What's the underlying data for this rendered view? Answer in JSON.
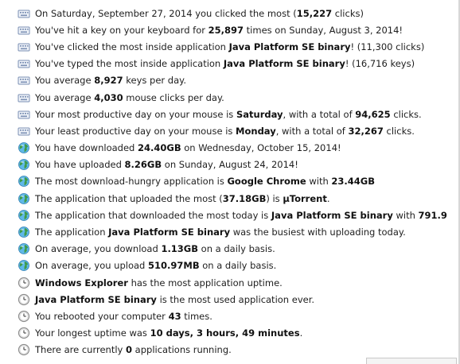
{
  "colors": {
    "keyboard_icon": "#7a8fb3",
    "globe_icon": "#3f9b48",
    "clock_icon": "#8c8c8c"
  },
  "rows": [
    {
      "icon": "keyboard-icon",
      "parts": [
        {
          "t": "On Saturday, September 27, 2014 you clicked the most ("
        },
        {
          "t": "15,227",
          "b": true
        },
        {
          "t": " clicks)"
        }
      ]
    },
    {
      "icon": "keyboard-icon",
      "parts": [
        {
          "t": "You've hit a key on your keyboard for "
        },
        {
          "t": "25,897",
          "b": true
        },
        {
          "t": " times on Sunday, August 3, 2014!"
        }
      ]
    },
    {
      "icon": "keyboard-icon",
      "parts": [
        {
          "t": "You've clicked the most inside application "
        },
        {
          "t": "Java Platform SE binary",
          "b": true
        },
        {
          "t": "! (11,300 clicks)"
        }
      ]
    },
    {
      "icon": "keyboard-icon",
      "parts": [
        {
          "t": "You've typed the most inside application "
        },
        {
          "t": "Java Platform SE binary",
          "b": true
        },
        {
          "t": "! (16,716 keys)"
        }
      ]
    },
    {
      "icon": "keyboard-icon",
      "parts": [
        {
          "t": "You average "
        },
        {
          "t": "8,927",
          "b": true
        },
        {
          "t": " keys per day."
        }
      ]
    },
    {
      "icon": "keyboard-icon",
      "parts": [
        {
          "t": "You average "
        },
        {
          "t": "4,030",
          "b": true
        },
        {
          "t": " mouse clicks per day."
        }
      ]
    },
    {
      "icon": "keyboard-icon",
      "parts": [
        {
          "t": "Your most productive day on your mouse is "
        },
        {
          "t": "Saturday",
          "b": true
        },
        {
          "t": ", with a total of "
        },
        {
          "t": "94,625",
          "b": true
        },
        {
          "t": " clicks."
        }
      ]
    },
    {
      "icon": "keyboard-icon",
      "parts": [
        {
          "t": "Your least productive day on your mouse is "
        },
        {
          "t": "Monday",
          "b": true
        },
        {
          "t": ", with a total of "
        },
        {
          "t": "32,267",
          "b": true
        },
        {
          "t": " clicks."
        }
      ]
    },
    {
      "icon": "globe-icon",
      "parts": [
        {
          "t": "You have downloaded "
        },
        {
          "t": "24.40GB",
          "b": true
        },
        {
          "t": " on Wednesday, October 15, 2014!"
        }
      ]
    },
    {
      "icon": "globe-icon",
      "parts": [
        {
          "t": "You have uploaded "
        },
        {
          "t": "8.26GB",
          "b": true
        },
        {
          "t": " on Sunday, August 24, 2014!"
        }
      ]
    },
    {
      "icon": "globe-icon",
      "parts": [
        {
          "t": "The most download-hungry application is "
        },
        {
          "t": "Google Chrome",
          "b": true
        },
        {
          "t": " with "
        },
        {
          "t": "23.44GB",
          "b": true
        }
      ]
    },
    {
      "icon": "globe-icon",
      "parts": [
        {
          "t": "The application that uploaded the most ("
        },
        {
          "t": "37.18GB",
          "b": true
        },
        {
          "t": ") is "
        },
        {
          "t": "µTorrent",
          "b": true
        },
        {
          "t": "."
        }
      ]
    },
    {
      "icon": "globe-icon",
      "parts": [
        {
          "t": "The application that downloaded the most today is "
        },
        {
          "t": "Java Platform SE binary",
          "b": true
        },
        {
          "t": " with "
        },
        {
          "t": "791.9",
          "b": true
        }
      ]
    },
    {
      "icon": "globe-icon",
      "parts": [
        {
          "t": "The application "
        },
        {
          "t": "Java Platform SE binary",
          "b": true
        },
        {
          "t": " was the busiest with uploading today."
        }
      ]
    },
    {
      "icon": "globe-icon",
      "parts": [
        {
          "t": "On average, you download "
        },
        {
          "t": "1.13GB",
          "b": true
        },
        {
          "t": " on a daily basis."
        }
      ]
    },
    {
      "icon": "globe-icon",
      "parts": [
        {
          "t": "On average, you upload "
        },
        {
          "t": "510.97MB",
          "b": true
        },
        {
          "t": " on a daily basis."
        }
      ]
    },
    {
      "icon": "clock-icon",
      "parts": [
        {
          "t": "Windows Explorer",
          "b": true
        },
        {
          "t": " has the most application uptime."
        }
      ]
    },
    {
      "icon": "clock-icon",
      "parts": [
        {
          "t": "Java Platform SE binary",
          "b": true
        },
        {
          "t": " is the most used application ever."
        }
      ]
    },
    {
      "icon": "clock-icon",
      "parts": [
        {
          "t": "You rebooted your computer "
        },
        {
          "t": "43",
          "b": true
        },
        {
          "t": " times."
        }
      ]
    },
    {
      "icon": "clock-icon",
      "parts": [
        {
          "t": "Your longest uptime was "
        },
        {
          "t": "10 days, 3 hours, 49 minutes",
          "b": true
        },
        {
          "t": "."
        }
      ]
    },
    {
      "icon": "clock-icon",
      "parts": [
        {
          "t": "There are currently "
        },
        {
          "t": "0",
          "b": true
        },
        {
          "t": " applications running."
        }
      ]
    }
  ]
}
